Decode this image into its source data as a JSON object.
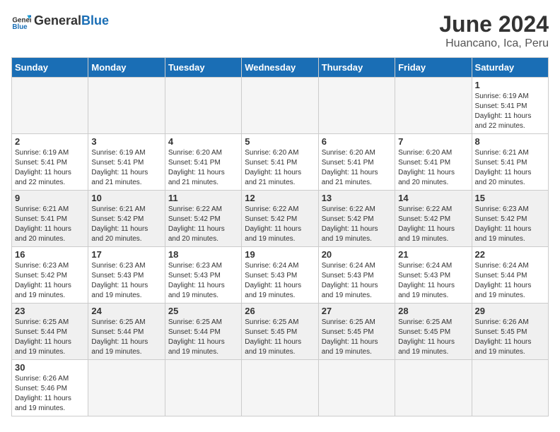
{
  "header": {
    "logo_general": "General",
    "logo_blue": "Blue",
    "month_title": "June 2024",
    "location": "Huancano, Ica, Peru"
  },
  "days_of_week": [
    "Sunday",
    "Monday",
    "Tuesday",
    "Wednesday",
    "Thursday",
    "Friday",
    "Saturday"
  ],
  "weeks": [
    {
      "cells": [
        {
          "day": null,
          "info": ""
        },
        {
          "day": null,
          "info": ""
        },
        {
          "day": null,
          "info": ""
        },
        {
          "day": null,
          "info": ""
        },
        {
          "day": null,
          "info": ""
        },
        {
          "day": null,
          "info": ""
        },
        {
          "day": "1",
          "info": "Sunrise: 6:19 AM\nSunset: 5:41 PM\nDaylight: 11 hours\nand 22 minutes."
        }
      ]
    },
    {
      "cells": [
        {
          "day": "2",
          "info": "Sunrise: 6:19 AM\nSunset: 5:41 PM\nDaylight: 11 hours\nand 22 minutes."
        },
        {
          "day": "3",
          "info": "Sunrise: 6:19 AM\nSunset: 5:41 PM\nDaylight: 11 hours\nand 21 minutes."
        },
        {
          "day": "4",
          "info": "Sunrise: 6:20 AM\nSunset: 5:41 PM\nDaylight: 11 hours\nand 21 minutes."
        },
        {
          "day": "5",
          "info": "Sunrise: 6:20 AM\nSunset: 5:41 PM\nDaylight: 11 hours\nand 21 minutes."
        },
        {
          "day": "6",
          "info": "Sunrise: 6:20 AM\nSunset: 5:41 PM\nDaylight: 11 hours\nand 21 minutes."
        },
        {
          "day": "7",
          "info": "Sunrise: 6:20 AM\nSunset: 5:41 PM\nDaylight: 11 hours\nand 20 minutes."
        },
        {
          "day": "8",
          "info": "Sunrise: 6:21 AM\nSunset: 5:41 PM\nDaylight: 11 hours\nand 20 minutes."
        }
      ]
    },
    {
      "cells": [
        {
          "day": "9",
          "info": "Sunrise: 6:21 AM\nSunset: 5:41 PM\nDaylight: 11 hours\nand 20 minutes."
        },
        {
          "day": "10",
          "info": "Sunrise: 6:21 AM\nSunset: 5:42 PM\nDaylight: 11 hours\nand 20 minutes."
        },
        {
          "day": "11",
          "info": "Sunrise: 6:22 AM\nSunset: 5:42 PM\nDaylight: 11 hours\nand 20 minutes."
        },
        {
          "day": "12",
          "info": "Sunrise: 6:22 AM\nSunset: 5:42 PM\nDaylight: 11 hours\nand 19 minutes."
        },
        {
          "day": "13",
          "info": "Sunrise: 6:22 AM\nSunset: 5:42 PM\nDaylight: 11 hours\nand 19 minutes."
        },
        {
          "day": "14",
          "info": "Sunrise: 6:22 AM\nSunset: 5:42 PM\nDaylight: 11 hours\nand 19 minutes."
        },
        {
          "day": "15",
          "info": "Sunrise: 6:23 AM\nSunset: 5:42 PM\nDaylight: 11 hours\nand 19 minutes."
        }
      ]
    },
    {
      "cells": [
        {
          "day": "16",
          "info": "Sunrise: 6:23 AM\nSunset: 5:42 PM\nDaylight: 11 hours\nand 19 minutes."
        },
        {
          "day": "17",
          "info": "Sunrise: 6:23 AM\nSunset: 5:43 PM\nDaylight: 11 hours\nand 19 minutes."
        },
        {
          "day": "18",
          "info": "Sunrise: 6:23 AM\nSunset: 5:43 PM\nDaylight: 11 hours\nand 19 minutes."
        },
        {
          "day": "19",
          "info": "Sunrise: 6:24 AM\nSunset: 5:43 PM\nDaylight: 11 hours\nand 19 minutes."
        },
        {
          "day": "20",
          "info": "Sunrise: 6:24 AM\nSunset: 5:43 PM\nDaylight: 11 hours\nand 19 minutes."
        },
        {
          "day": "21",
          "info": "Sunrise: 6:24 AM\nSunset: 5:43 PM\nDaylight: 11 hours\nand 19 minutes."
        },
        {
          "day": "22",
          "info": "Sunrise: 6:24 AM\nSunset: 5:44 PM\nDaylight: 11 hours\nand 19 minutes."
        }
      ]
    },
    {
      "cells": [
        {
          "day": "23",
          "info": "Sunrise: 6:25 AM\nSunset: 5:44 PM\nDaylight: 11 hours\nand 19 minutes."
        },
        {
          "day": "24",
          "info": "Sunrise: 6:25 AM\nSunset: 5:44 PM\nDaylight: 11 hours\nand 19 minutes."
        },
        {
          "day": "25",
          "info": "Sunrise: 6:25 AM\nSunset: 5:44 PM\nDaylight: 11 hours\nand 19 minutes."
        },
        {
          "day": "26",
          "info": "Sunrise: 6:25 AM\nSunset: 5:45 PM\nDaylight: 11 hours\nand 19 minutes."
        },
        {
          "day": "27",
          "info": "Sunrise: 6:25 AM\nSunset: 5:45 PM\nDaylight: 11 hours\nand 19 minutes."
        },
        {
          "day": "28",
          "info": "Sunrise: 6:25 AM\nSunset: 5:45 PM\nDaylight: 11 hours\nand 19 minutes."
        },
        {
          "day": "29",
          "info": "Sunrise: 6:26 AM\nSunset: 5:45 PM\nDaylight: 11 hours\nand 19 minutes."
        }
      ]
    },
    {
      "cells": [
        {
          "day": "30",
          "info": "Sunrise: 6:26 AM\nSunset: 5:46 PM\nDaylight: 11 hours\nand 19 minutes."
        },
        {
          "day": null,
          "info": ""
        },
        {
          "day": null,
          "info": ""
        },
        {
          "day": null,
          "info": ""
        },
        {
          "day": null,
          "info": ""
        },
        {
          "day": null,
          "info": ""
        },
        {
          "day": null,
          "info": ""
        }
      ]
    }
  ]
}
